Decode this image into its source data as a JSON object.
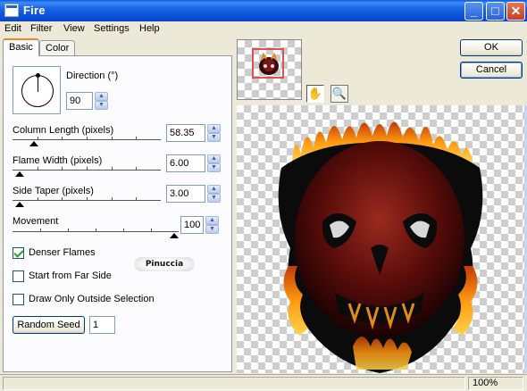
{
  "window": {
    "title": "Fire"
  },
  "menu": [
    "Edit",
    "Filter",
    "View",
    "Settings",
    "Help"
  ],
  "tabs": {
    "basic": "Basic",
    "color": "Color"
  },
  "direction": {
    "label": "Direction (°)",
    "value": "90"
  },
  "column_length": {
    "label": "Column Length (pixels)",
    "value": "58.35",
    "slider_fraction": 0.12
  },
  "flame_width": {
    "label": "Flame Width (pixels)",
    "value": "6.00",
    "slider_fraction": 0.02
  },
  "side_taper": {
    "label": "Side Taper (pixels)",
    "value": "3.00",
    "slider_fraction": 0.02
  },
  "movement": {
    "label": "Movement",
    "value": "100",
    "slider_fraction": 1.0
  },
  "options": {
    "denser_flames": {
      "label": "Denser Flames",
      "checked": true
    },
    "start_far_side": {
      "label": "Start from Far Side",
      "checked": false
    },
    "draw_outside": {
      "label": "Draw Only Outside Selection",
      "checked": false
    }
  },
  "random_seed": {
    "label": "Random Seed",
    "value": "1"
  },
  "watermark": "Pinuccia",
  "buttons": {
    "ok": "OK",
    "cancel": "Cancel"
  },
  "tools": {
    "pan": "pan-hand-icon",
    "zoom": "zoom-magnifier-icon"
  },
  "status": {
    "zoom": "100%"
  },
  "colors": {
    "accent_tab": "#e68b2c",
    "title_bar": "#0a4fd8"
  }
}
